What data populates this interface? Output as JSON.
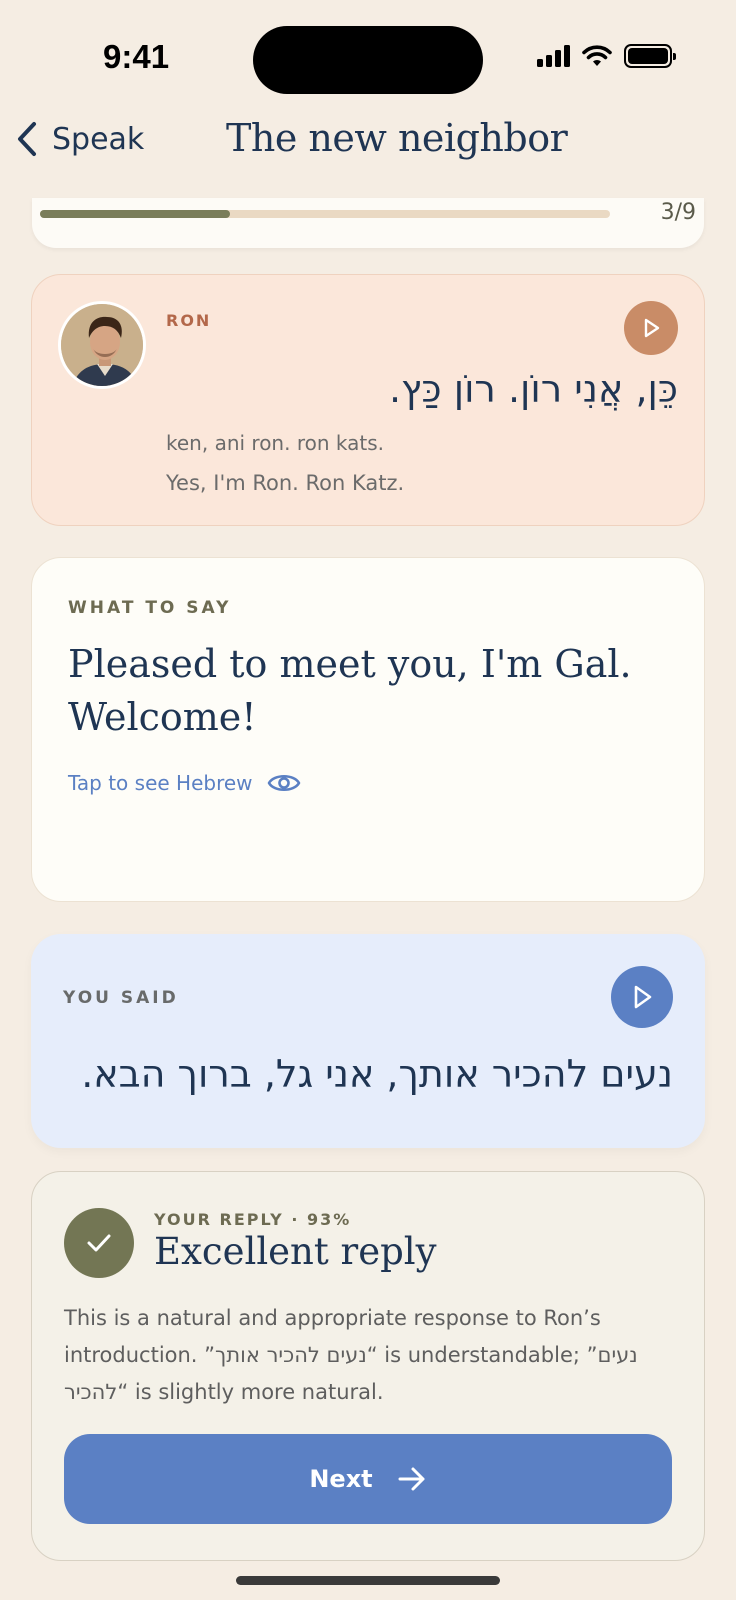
{
  "status_bar": {
    "time": "9:41"
  },
  "nav": {
    "back_label": "Speak",
    "title": "The new neighbor"
  },
  "progress": {
    "label": "3/9",
    "fraction": 0.333
  },
  "ron_message": {
    "speaker": "RON",
    "hebrew": "כֵּן, אֲנִי רוֹן. רוֹן כַּץ.",
    "transliteration": "ken, ani ron. ron kats.",
    "english": "Yes, I'm Ron. Ron Katz."
  },
  "prompt": {
    "label": "WHAT TO SAY",
    "text": "Pleased to meet you, I'm Gal. Welcome!",
    "reveal_label": "Tap to see Hebrew"
  },
  "you_said": {
    "label": "YOU SAID",
    "hebrew": "נעים להכיר אותך, אני גל, ברוך הבא."
  },
  "reply": {
    "meta": "YOUR REPLY · 93%",
    "title": "Excellent reply",
    "body": "This is a natural and appropriate response to Ron’s introduction. ”נעים להכיר אותך“ is understandable; ”נעים להכיר“ is slightly more natural.",
    "next_label": "Next"
  },
  "colors": {
    "background": "#f5ede3",
    "ron_card": "#fbe7da",
    "said_card": "#e6edfb",
    "accent_blue": "#5b80c4",
    "accent_olive": "#737654",
    "accent_terracotta": "#c98c67"
  },
  "icons": {
    "back": "chevron-left-icon",
    "play": "play-icon",
    "reveal": "eye-icon",
    "success": "check-icon",
    "next": "arrow-right-icon"
  }
}
